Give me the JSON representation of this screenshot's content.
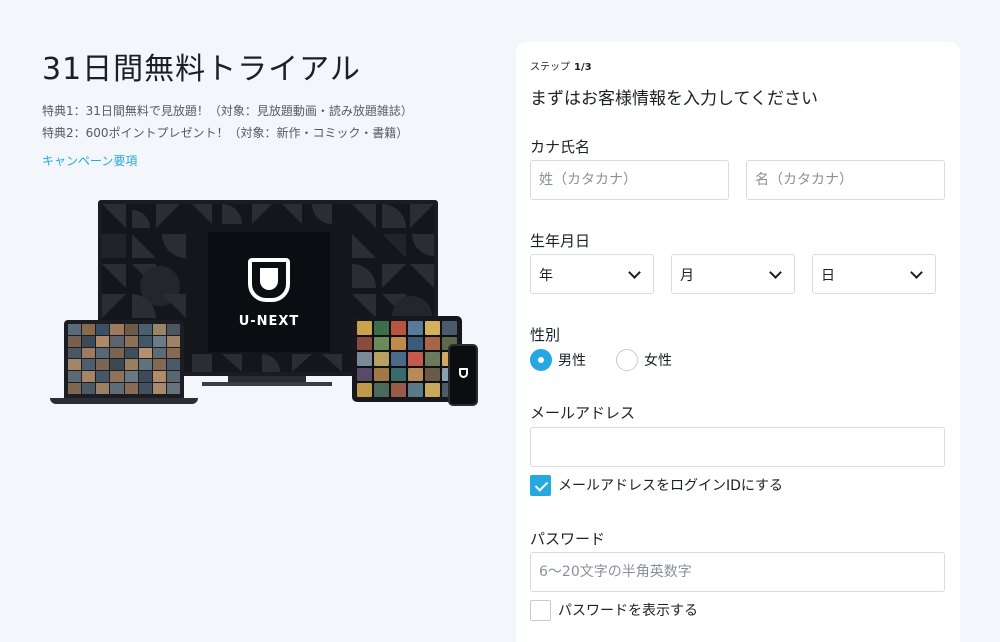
{
  "left": {
    "title": "31日間無料トライアル",
    "perk1": "特典1：31日間無料で見放題！（対象：見放題動画・読み放題雑誌）",
    "perk2": "特典2：600ポイントプレゼント！（対象：新作・コミック・書籍）",
    "campaign_link": "キャンペーン要項",
    "brand_logo_text": "U-NEXT"
  },
  "form": {
    "step_label": "ステップ",
    "step_value": "1/3",
    "heading": "まずはお客様情報を入力してください",
    "kana_name": {
      "label": "カナ氏名",
      "last_placeholder": "姓（カタカナ）",
      "first_placeholder": "名（カタカナ）"
    },
    "birthdate": {
      "label": "生年月日",
      "year": "年",
      "month": "月",
      "day": "日"
    },
    "gender": {
      "label": "性別",
      "options": [
        "男性",
        "女性"
      ],
      "selected": "男性"
    },
    "email": {
      "label": "メールアドレス",
      "value": "",
      "use_as_login_label": "メールアドレスをログインIDにする",
      "use_as_login_checked": true
    },
    "password": {
      "label": "パスワード",
      "placeholder": "6〜20文字の半角英数字",
      "show_label": "パスワードを表示する",
      "show_checked": false
    }
  },
  "colors": {
    "accent": "#25a9e0",
    "background": "#f3f6fa",
    "card": "#ffffff"
  }
}
